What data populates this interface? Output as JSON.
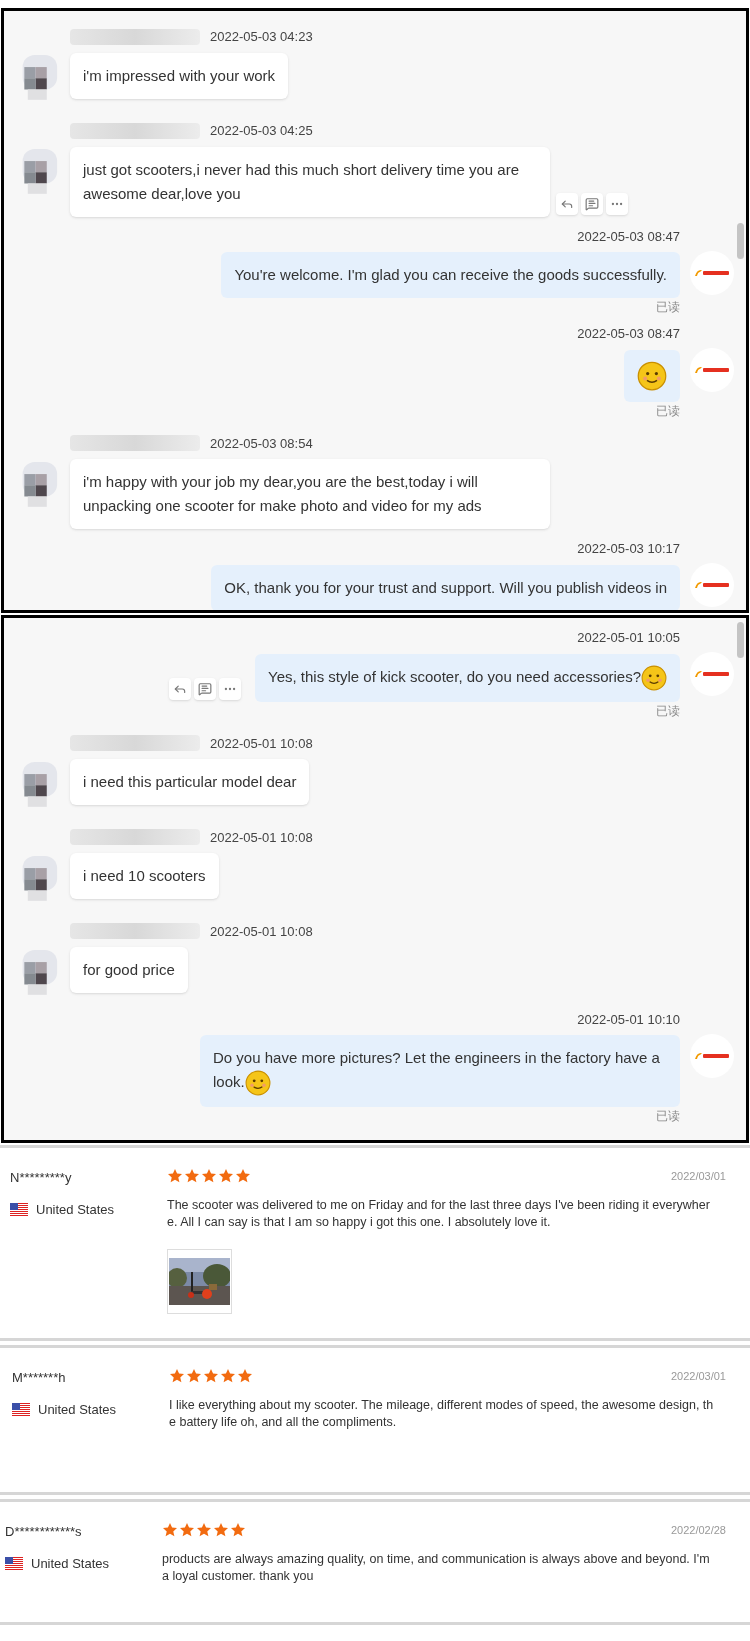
{
  "chat_panels": [
    {
      "messages": [
        {
          "kind": "customer",
          "time": "2022-05-03 04:23",
          "text": "i'm impressed with your work",
          "actions": false
        },
        {
          "kind": "customer",
          "time": "2022-05-03 04:25",
          "text": "just got scooters,i never had this much short delivery time you are awesome dear,love you",
          "actions": true
        },
        {
          "kind": "seller",
          "time": "2022-05-03 08:47",
          "text": "You're welcome. I'm glad you can receive the goods successfully.",
          "read_label": "已读",
          "actions": false
        },
        {
          "kind": "seller",
          "time": "2022-05-03 08:47",
          "emoji": true,
          "read_label": "已读",
          "actions": false
        },
        {
          "kind": "customer",
          "time": "2022-05-03 08:54",
          "text": "i'm happy with your job my dear,you are the best,today i will unpacking one scooter for make photo and video for my ads",
          "actions": false
        },
        {
          "kind": "seller",
          "time": "2022-05-03 10:17",
          "text": "OK, thank you for your trust and support. Will you publish videos in",
          "actions": false
        }
      ]
    },
    {
      "messages": [
        {
          "kind": "seller",
          "time": "2022-05-01 10:05",
          "text": "Yes, this style of kick scooter, do you need accessories?",
          "emoji": true,
          "read_label": "已读",
          "actions": true
        },
        {
          "kind": "customer",
          "time": "2022-05-01 10:08",
          "text": "i need this particular model dear",
          "actions": false
        },
        {
          "kind": "customer",
          "time": "2022-05-01 10:08",
          "text": "i need 10 scooters",
          "actions": false
        },
        {
          "kind": "customer",
          "time": "2022-05-01 10:08",
          "text": "for good price",
          "actions": false
        },
        {
          "kind": "seller",
          "time": "2022-05-01 10:10",
          "text": "Do you have more pictures? Let the engineers in the factory have a look.",
          "emoji": true,
          "read_label": "已读",
          "actions": false
        }
      ]
    }
  ],
  "reviews": [
    {
      "author": "N*********y",
      "country": "United States",
      "stars": 5,
      "date": "2022/03/01",
      "text": "The scooter was delivered to me on Friday and for the last three days I've been riding it everywhere. All I can say is that I am so happy i got this one. I absolutely love it.",
      "photos": [
        {
          "kind": "picture"
        }
      ]
    },
    {
      "author": "M*******h",
      "country": "United States",
      "stars": 5,
      "date": "2022/03/01",
      "text": "I like everything about my scooter. The mileage, different modes of speed, the awesome design, the battery life oh, and all the compliments."
    },
    {
      "author": "D************s",
      "country": "United States",
      "stars": 5,
      "date": "2022/02/28",
      "text": "products are always amazing quality, on time, and communication is always above and beyond. I'm a loyal customer. thank you"
    }
  ]
}
